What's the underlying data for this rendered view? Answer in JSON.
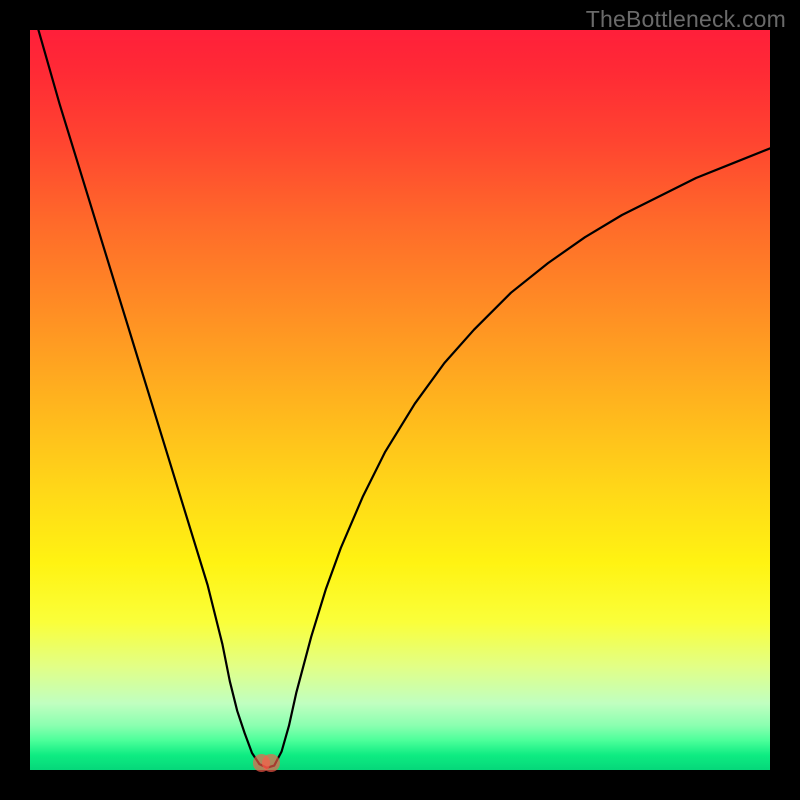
{
  "watermark": "TheBottleneck.com",
  "chart_data": {
    "type": "line",
    "title": "",
    "xlabel": "",
    "ylabel": "",
    "xlim": [
      0,
      100
    ],
    "ylim": [
      0,
      100
    ],
    "grid": false,
    "legend": false,
    "background_gradient": {
      "direction": "vertical",
      "stops": [
        {
          "pos": 0,
          "color": "#ff1f3a",
          "meaning": "high-bottleneck"
        },
        {
          "pos": 50,
          "color": "#ffb31e",
          "meaning": "moderate"
        },
        {
          "pos": 100,
          "color": "#06d77a",
          "meaning": "no-bottleneck"
        }
      ]
    },
    "series": [
      {
        "name": "bottleneck-curve",
        "color": "#000000",
        "x": [
          0,
          2,
          4,
          6,
          8,
          10,
          12,
          14,
          16,
          18,
          20,
          22,
          24,
          26,
          27,
          28,
          29,
          30,
          31,
          32,
          33,
          34,
          35,
          36,
          38,
          40,
          42,
          45,
          48,
          52,
          56,
          60,
          65,
          70,
          75,
          80,
          85,
          90,
          95,
          100
        ],
        "y": [
          104,
          97,
          90,
          83.5,
          77,
          70.5,
          64,
          57.5,
          51,
          44.5,
          38,
          31.5,
          25,
          17,
          12,
          8,
          5,
          2.3,
          0.8,
          0.3,
          0.6,
          2.5,
          6,
          10.5,
          18,
          24.5,
          30,
          37,
          43,
          49.5,
          55,
          59.5,
          64.5,
          68.5,
          72,
          75,
          77.5,
          80,
          82,
          84
        ]
      }
    ],
    "markers": [
      {
        "x": 31.3,
        "y": 0.9,
        "r": 1.2,
        "color": "#ff5a4a"
      },
      {
        "x": 32.6,
        "y": 0.9,
        "r": 1.2,
        "color": "#ff5a4a"
      }
    ],
    "minimum_at_x": 32
  }
}
